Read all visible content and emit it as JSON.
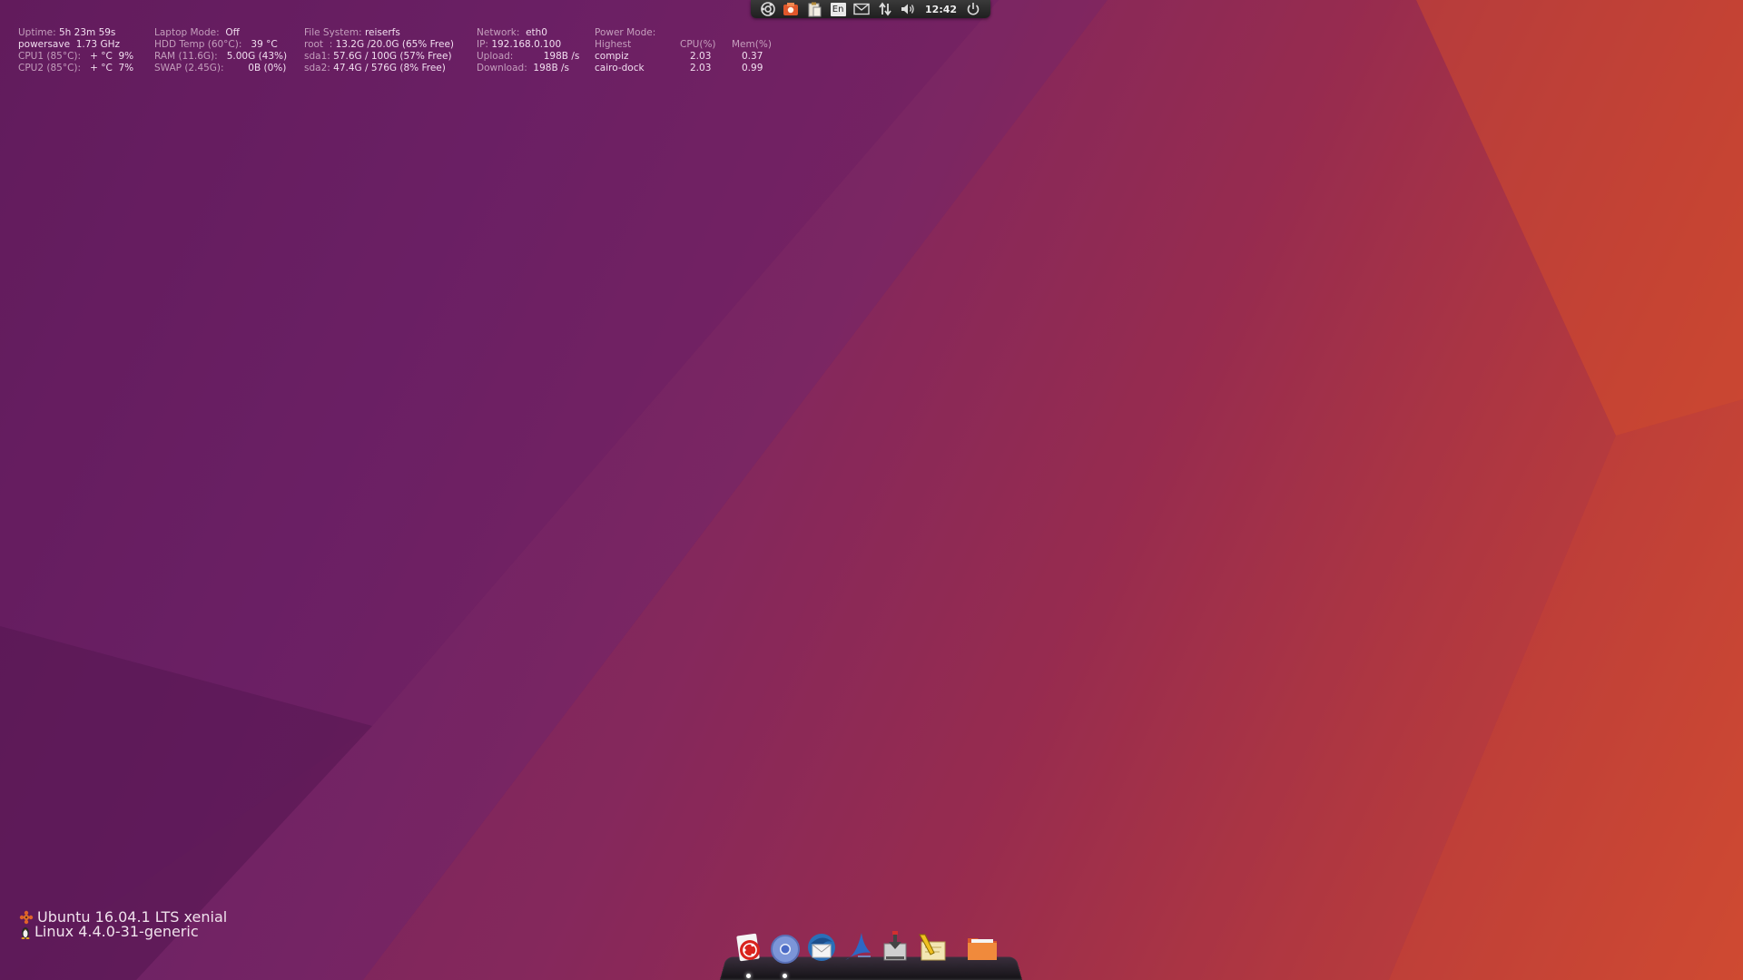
{
  "top_panel": {
    "clock": "12:42",
    "language": "En",
    "icons": [
      "ubuntu-logo-icon",
      "screenshot-tool-icon",
      "clipboard-icon",
      "keyboard-language-icon",
      "mail-icon",
      "network-arrows-icon",
      "volume-icon",
      "power-icon"
    ]
  },
  "conky": {
    "col1": {
      "l1_label": "Uptime:",
      "l1_value": "5h 23m 59s",
      "l2_label": "powersave",
      "l2_value": "1.73 GHz",
      "l3_label": "CPU1 (85°C):",
      "l3_value": "+ °C  9%",
      "l4_label": "CPU2 (85°C):",
      "l4_value": "+ °C  7%"
    },
    "col2": {
      "l1_label": "Laptop Mode:",
      "l1_value": "Off",
      "l2_label": "HDD Temp (60°C):",
      "l2_value": "39 °C",
      "l3_label": "RAM (11.6G):",
      "l3_value": "5.00G (43%)",
      "l4_label": "SWAP (2.45G):",
      "l4_value": "0B (0%)"
    },
    "col3": {
      "l1_label": "File System:",
      "l1_value": "reiserfs",
      "l2_label": "root  :",
      "l2_value": "13.2G /20.0G (65% Free)",
      "l3_label": "sda1:",
      "l3_value": "57.6G / 100G (57% Free)",
      "l4_label": "sda2:",
      "l4_value": "47.4G / 576G (8% Free)"
    },
    "col4": {
      "l1_label": "Network:",
      "l1_value": "eth0",
      "l2_label": "IP:",
      "l2_value": "192.168.0.100",
      "l3_label": "Upload:",
      "l3_value": "198B /s",
      "l4_label": "Download:",
      "l4_value": "198B /s"
    },
    "col5": {
      "l1_label": "Power Mode:",
      "l2_label": "Highest",
      "cpu_header": "CPU(%)",
      "mem_header": "Mem(%)",
      "processes": [
        {
          "name": "compiz",
          "cpu": "2.03",
          "mem": "0.37"
        },
        {
          "name": "cairo-dock",
          "cpu": "2.03",
          "mem": "0.99"
        }
      ]
    }
  },
  "os_info": {
    "release": "Ubuntu 16.04.1 LTS xenial",
    "kernel": "Linux 4.4.0-31-generic"
  },
  "dock": {
    "items": [
      "ubuntu-software-icon",
      "chromium-browser-icon",
      "thunderbird-icon",
      "kdenlive-icon",
      "installer-icon",
      "text-editor-icon",
      "file-manager-icon"
    ]
  },
  "colors": {
    "wallpaper_left": "#5e1a57",
    "wallpaper_mid": "#93294f",
    "wallpaper_right": "#d64f2c",
    "panel_bg": "#2a2a2a",
    "conky_text": "#e3c9dc"
  }
}
